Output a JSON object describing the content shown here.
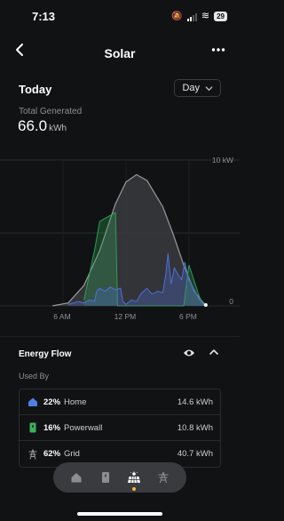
{
  "status": {
    "time": "7:13",
    "battery": "29"
  },
  "nav": {
    "title": "Solar",
    "back_icon": "chevron-left-icon",
    "more_icon": "more-icon"
  },
  "summary": {
    "period_label": "Today",
    "range_select": "Day",
    "total_label": "Total Generated",
    "total_value": "66.0",
    "total_unit": "kWh"
  },
  "chart_data": {
    "type": "area",
    "x_tick_labels": [
      "6 AM",
      "12 PM",
      "6 PM"
    ],
    "y_tick_labels": [
      "10 kW",
      "0"
    ],
    "ylim": [
      0,
      10
    ],
    "xlim": [
      0,
      24
    ],
    "grid": true,
    "series": [
      {
        "x": [
          5.0,
          6.5,
          8.0,
          9.5,
          11.0,
          12.0,
          13.0,
          14.0,
          15.5,
          16.5,
          17.5,
          18.5,
          19.5
        ],
        "y": [
          0.0,
          0.2,
          1.4,
          3.8,
          7.0,
          8.5,
          9.0,
          8.6,
          6.8,
          4.9,
          2.8,
          1.0,
          0.1
        ],
        "color": "#9a9a9c"
      },
      {
        "x": [
          6.5,
          7.5,
          8.0,
          8.5,
          9.0,
          9.2,
          9.5,
          10.0,
          10.5,
          11.0,
          11.5,
          11.7,
          12.0,
          12.5,
          13.0,
          13.5,
          14.0,
          14.5,
          15.0,
          15.5,
          15.8,
          16.0,
          16.3,
          16.6,
          17.0,
          17.3,
          17.6,
          18.0,
          18.5,
          19.0,
          19.5
        ],
        "y": [
          0.1,
          0.3,
          0.2,
          0.4,
          0.3,
          1.0,
          1.2,
          1.0,
          1.3,
          1.1,
          1.2,
          0.3,
          0.1,
          0.4,
          0.3,
          0.9,
          1.2,
          0.8,
          1.0,
          0.9,
          2.2,
          3.6,
          1.5,
          2.6,
          2.1,
          1.8,
          3.0,
          1.8,
          1.1,
          0.4,
          0.0
        ],
        "color": "#4f6fd6"
      },
      {
        "x": [
          8.0,
          9.0,
          9.5,
          11.0,
          11.2,
          17.5,
          18.0,
          19.0,
          19.5
        ],
        "y": [
          0.4,
          3.8,
          5.8,
          6.4,
          0.0,
          0.0,
          2.8,
          0.6,
          0.0
        ],
        "color": "#2e9e56"
      }
    ],
    "now_x": 19.6
  },
  "energy_flow": {
    "title": "Energy Flow",
    "used_by_label": "Used By",
    "eye_icon": "eye-icon",
    "collapse_icon": "chevron-up-icon",
    "rows": [
      {
        "pct": "22%",
        "name": "Home",
        "value": "14.6 kWh",
        "icon": "home-icon",
        "color": "#4f7ee6"
      },
      {
        "pct": "16%",
        "name": "Powerwall",
        "value": "10.8 kWh",
        "icon": "powerwall-icon",
        "color": "#3bb15f"
      },
      {
        "pct": "62%",
        "name": "Grid",
        "value": "40.7 kWh",
        "icon": "grid-tower-icon",
        "color": "#9a9a9c"
      }
    ]
  },
  "tabs": [
    {
      "name": "home-tab",
      "icon": "home-icon"
    },
    {
      "name": "powerwall-tab",
      "icon": "powerwall-icon"
    },
    {
      "name": "solar-tab",
      "icon": "solar-panel-icon",
      "active": true
    },
    {
      "name": "grid-tab",
      "icon": "grid-tower-icon"
    }
  ],
  "colors": {
    "accent": "#f3b73a",
    "background": "#111214"
  }
}
